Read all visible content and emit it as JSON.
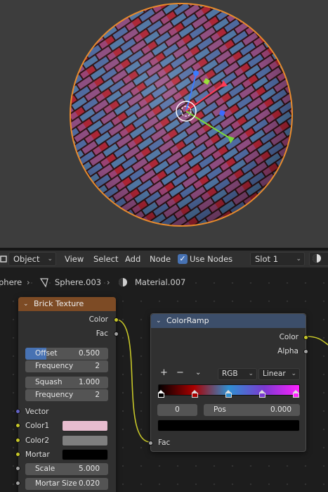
{
  "header": {
    "mode": "Object",
    "menus": [
      "View",
      "Select",
      "Add",
      "Node"
    ],
    "use_nodes_label": "Use Nodes",
    "use_nodes_checked": true,
    "slot": "Slot 1"
  },
  "breadcrumb": {
    "items": [
      "phere",
      "Sphere.003",
      "Material.007"
    ]
  },
  "brick_node": {
    "title": "Brick Texture",
    "outputs": [
      "Color",
      "Fac"
    ],
    "offset": {
      "label": "Offset",
      "value": "0.500",
      "fill": 0.5
    },
    "offset_frequency": {
      "label": "Frequency",
      "value": "2"
    },
    "squash": {
      "label": "Squash",
      "value": "1.000"
    },
    "squash_frequency": {
      "label": "Frequency",
      "value": "2"
    },
    "inputs": [
      "Vector",
      "Color1",
      "Color2",
      "Mortar"
    ],
    "colors": {
      "color1": "#e8bccf",
      "color2": "#7f7f7f",
      "mortar": "#000000"
    },
    "scale": {
      "label": "Scale",
      "value": "5.000"
    },
    "mortar_size": {
      "label": "Mortar Size",
      "value": "0.020"
    }
  },
  "colorramp_node": {
    "title": "ColorRamp",
    "outputs": [
      "Color",
      "Alpha"
    ],
    "add_label": "+",
    "remove_label": "−",
    "color_mode": "RGB",
    "interpolation": "Linear",
    "stops": [
      {
        "pos": 0.0,
        "color": "#000000"
      },
      {
        "pos": 0.25,
        "color": "#aa0000"
      },
      {
        "pos": 0.5,
        "color": "#2f8fd0"
      },
      {
        "pos": 0.75,
        "color": "#7a3ad0"
      },
      {
        "pos": 1.0,
        "color": "#ff20ff"
      }
    ],
    "active_index": "0",
    "pos_label": "Pos",
    "pos_value": "0.000",
    "active_color": "#000000",
    "input": "Fac"
  }
}
